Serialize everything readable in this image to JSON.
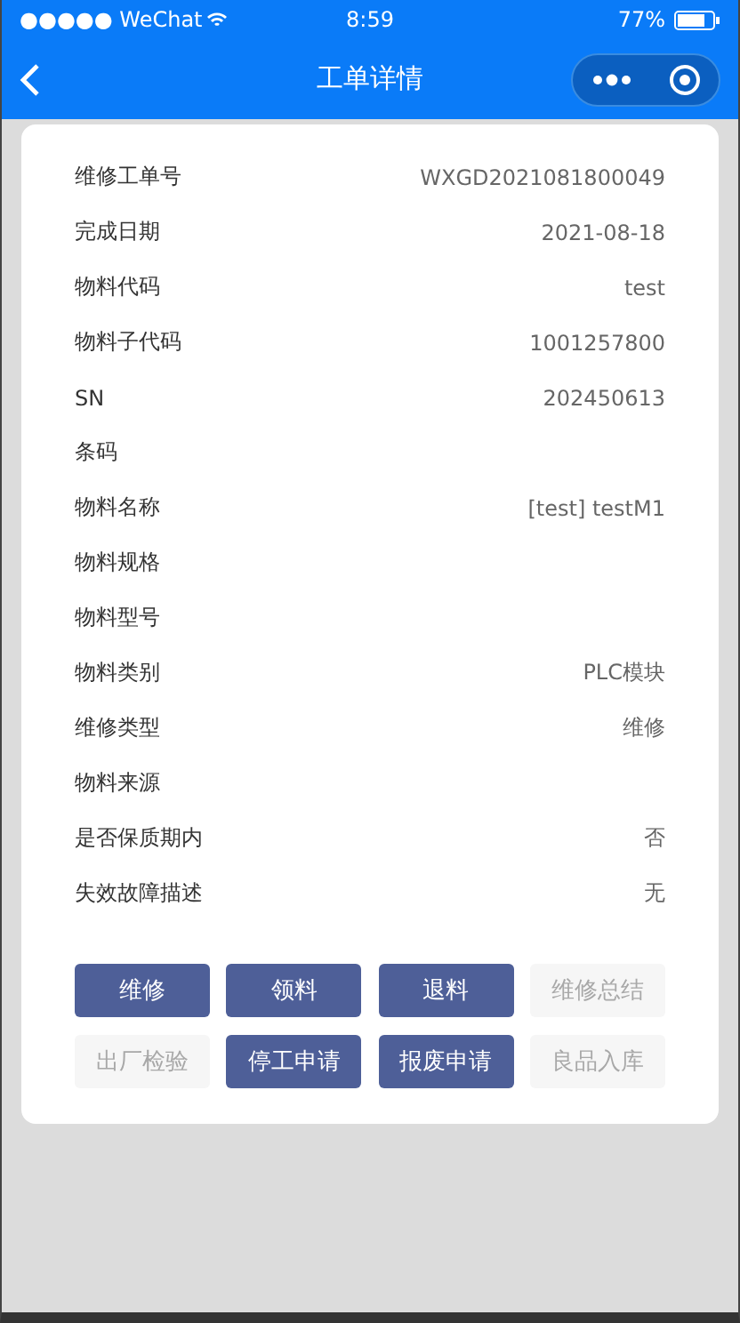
{
  "status_bar": {
    "signal": "●●●●● WeChat",
    "time": "8:59",
    "battery": "77%"
  },
  "nav": {
    "title": "工单详情"
  },
  "fields": [
    {
      "label": "维修工单号",
      "value": "WXGD2021081800049"
    },
    {
      "label": "完成日期",
      "value": "2021-08-18"
    },
    {
      "label": "物料代码",
      "value": "test"
    },
    {
      "label": "物料子代码",
      "value": "1001257800"
    },
    {
      "label": "SN",
      "value": "202450613"
    },
    {
      "label": "条码"
    },
    {
      "label": "物料名称",
      "value": "[test] testM1"
    },
    {
      "label": "物料规格"
    },
    {
      "label": "物料型号"
    },
    {
      "label": "物料类别",
      "value": "PLC模块"
    },
    {
      "label": "维修类型",
      "value": "维修"
    },
    {
      "label": "物料来源"
    },
    {
      "label": "是否保质期内",
      "value": "否"
    },
    {
      "label": "失效故障描述",
      "value": "无"
    }
  ],
  "buttons": [
    {
      "label": "维修",
      "disabled": false
    },
    {
      "label": "领料",
      "disabled": false
    },
    {
      "label": "退料",
      "disabled": false
    },
    {
      "label": "维修总结",
      "disabled": true
    },
    {
      "label": "出厂检验",
      "disabled": true
    },
    {
      "label": "停工申请",
      "disabled": false
    },
    {
      "label": "报废申请",
      "disabled": false
    },
    {
      "label": "良品入库",
      "disabled": true
    }
  ]
}
